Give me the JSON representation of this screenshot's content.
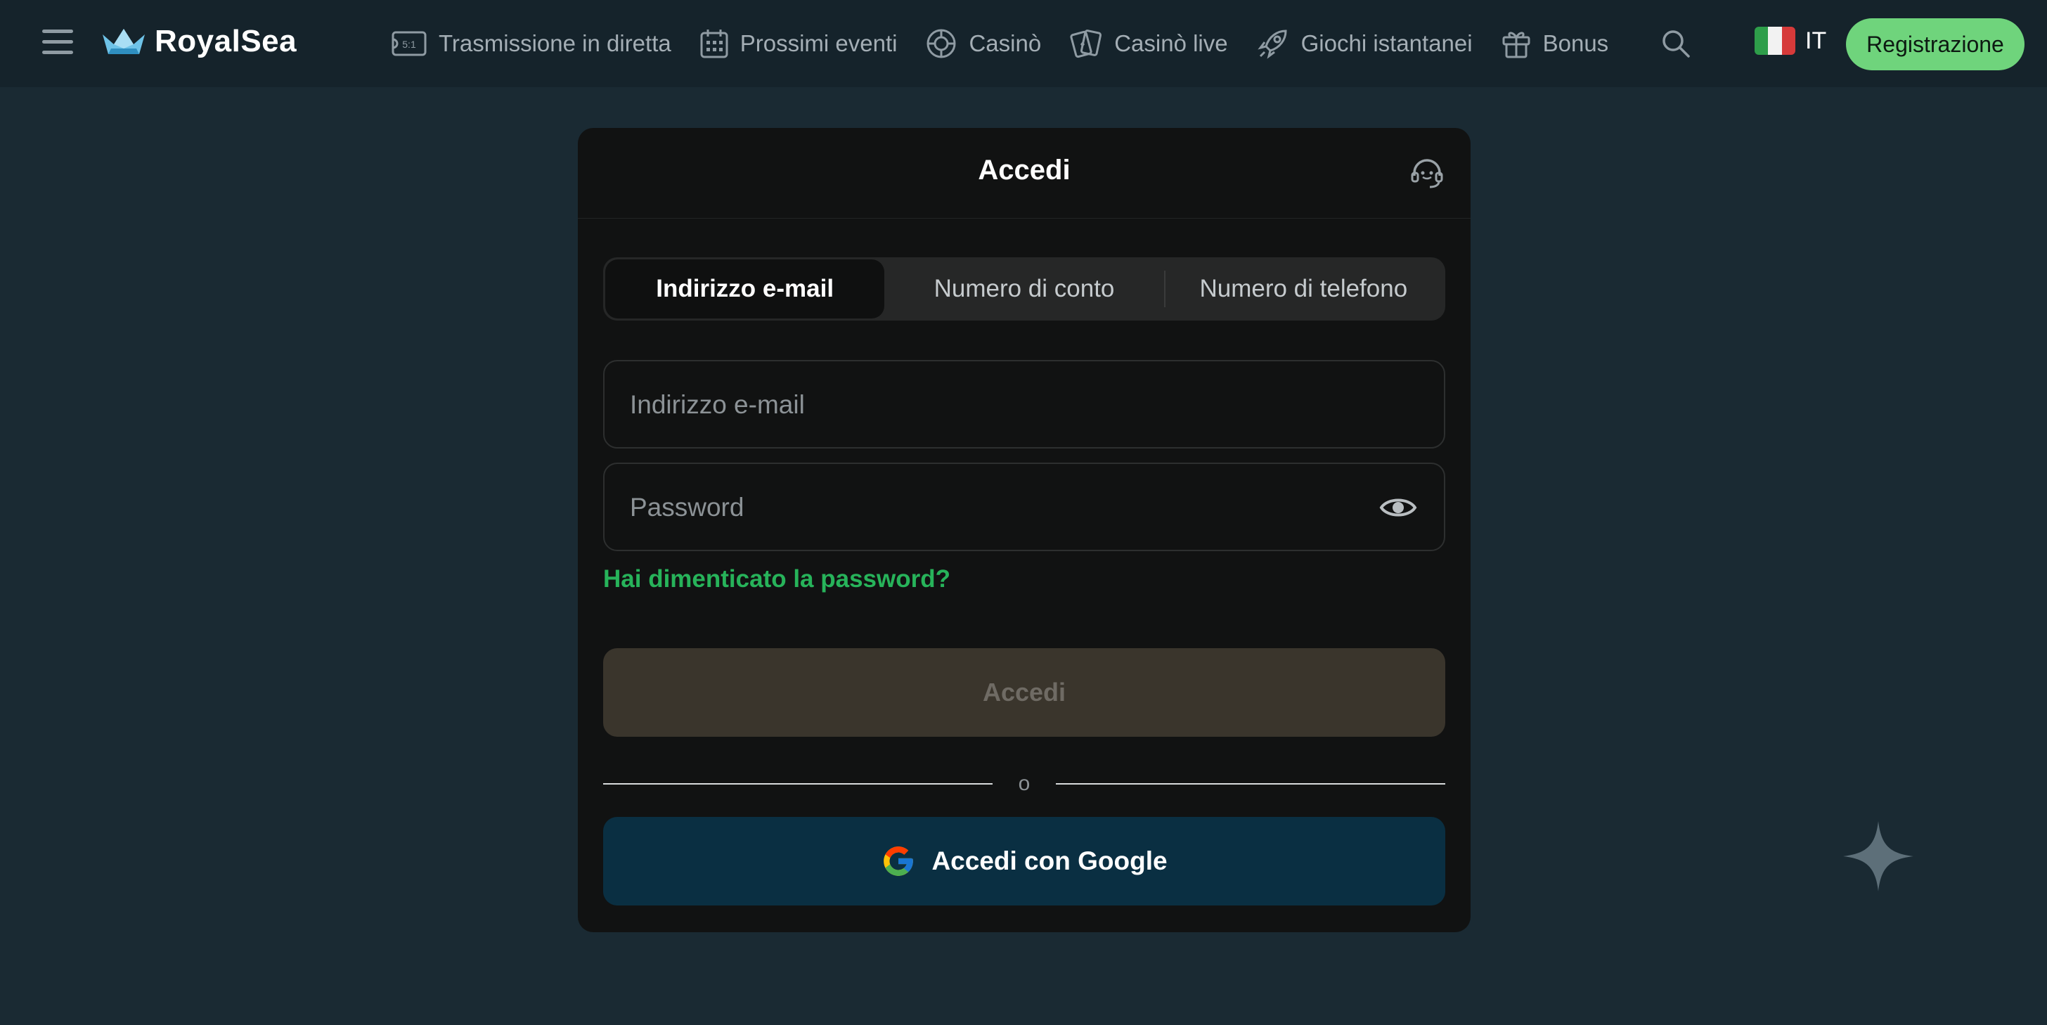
{
  "header": {
    "brand": "RoyalSea",
    "nav": [
      {
        "label": "Trasmissione in diretta",
        "icon": "ticket-icon"
      },
      {
        "label": "Prossimi eventi",
        "icon": "calendar-icon"
      },
      {
        "label": "Casinò",
        "icon": "roulette-icon"
      },
      {
        "label": "Casinò live",
        "icon": "cards-icon"
      },
      {
        "label": "Giochi istantanei",
        "icon": "rocket-icon"
      },
      {
        "label": "Bonus",
        "icon": "gift-icon"
      }
    ],
    "language": "IT",
    "register_label": "Registrazione"
  },
  "modal": {
    "title": "Accedi",
    "tabs": [
      {
        "label": "Indirizzo e-mail",
        "active": true
      },
      {
        "label": "Numero di conto",
        "active": false
      },
      {
        "label": "Numero di telefono",
        "active": false
      }
    ],
    "email": {
      "placeholder": "Indirizzo e-mail",
      "value": ""
    },
    "password": {
      "placeholder": "Password",
      "value": ""
    },
    "forgot_label": "Hai dimenticato la password?",
    "submit_label": "Accedi",
    "separator_label": "o",
    "google_label": "Accedi con Google"
  },
  "colors": {
    "page_bg": "#1a2a33",
    "header_bg": "#15232b",
    "modal_bg": "#111212",
    "accent_green": "#6fd47c",
    "link_green": "#27b35a",
    "google_button_bg": "#0a2f42"
  }
}
